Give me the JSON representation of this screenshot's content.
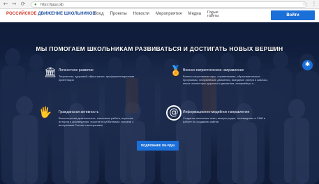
{
  "browser": {
    "back_glyph": "←",
    "forward_glyph": "→",
    "reload_glyph": "⟳",
    "url": "https://рдш.рф",
    "star_glyph": "☆",
    "menu_glyph": "⋮"
  },
  "header": {
    "logo_part1": "РОССИЙСКОЕ",
    "logo_part2": "ДВИЖЕНИЕ ШКОЛЬНИКОВ",
    "nav": [
      "Вход",
      "Проекты",
      "Новости",
      "Мероприятия",
      "Медиа"
    ],
    "nav_multi_top": "Голые",
    "nav_multi_bottom": "газеты",
    "search_glyph": "🔍",
    "login_label": "Войти"
  },
  "hero": {
    "title": "МЫ ПОМОГАЕМ ШКОЛЬНИКАМ РАЗВИВАТЬСЯ И ДОСТИГАТЬ НОВЫХ ВЕРШИН",
    "features": [
      {
        "icon": "🏛",
        "title": "Личностное развитие",
        "text": "Творчество, здоровый образ жизни, профориентационная ориентация"
      },
      {
        "icon": "🏅",
        "title": "Военно-патриотическое направление",
        "text": "Военно-спортивные игры, соревнования, образовательные программы, юнармейские движения, выездные лагеря и казачьи, юные инспекторы дорожного движения, юнармейцы и..."
      },
      {
        "icon": "🖐",
        "title": "Гражданская активность",
        "text": "Волонтерская деятельность, поисковая работа, изучение истории и краеведения, участие в субботниках, встречи с ветеранами России и ветеранами"
      },
      {
        "icon": "@",
        "title": "Информационно-медийное направление",
        "text": "Создание школьных газет, выпуск радио, телевидение и СМИ в работе по созданию сайтов"
      }
    ],
    "more_button": "ПОДРОБНЕЕ ОБ РДШ",
    "accessibility_glyph": "✱"
  },
  "colors": {
    "brand_blue": "#1b6fd8",
    "brand_red": "#d23a2b",
    "hero_bg": "#13203d"
  }
}
